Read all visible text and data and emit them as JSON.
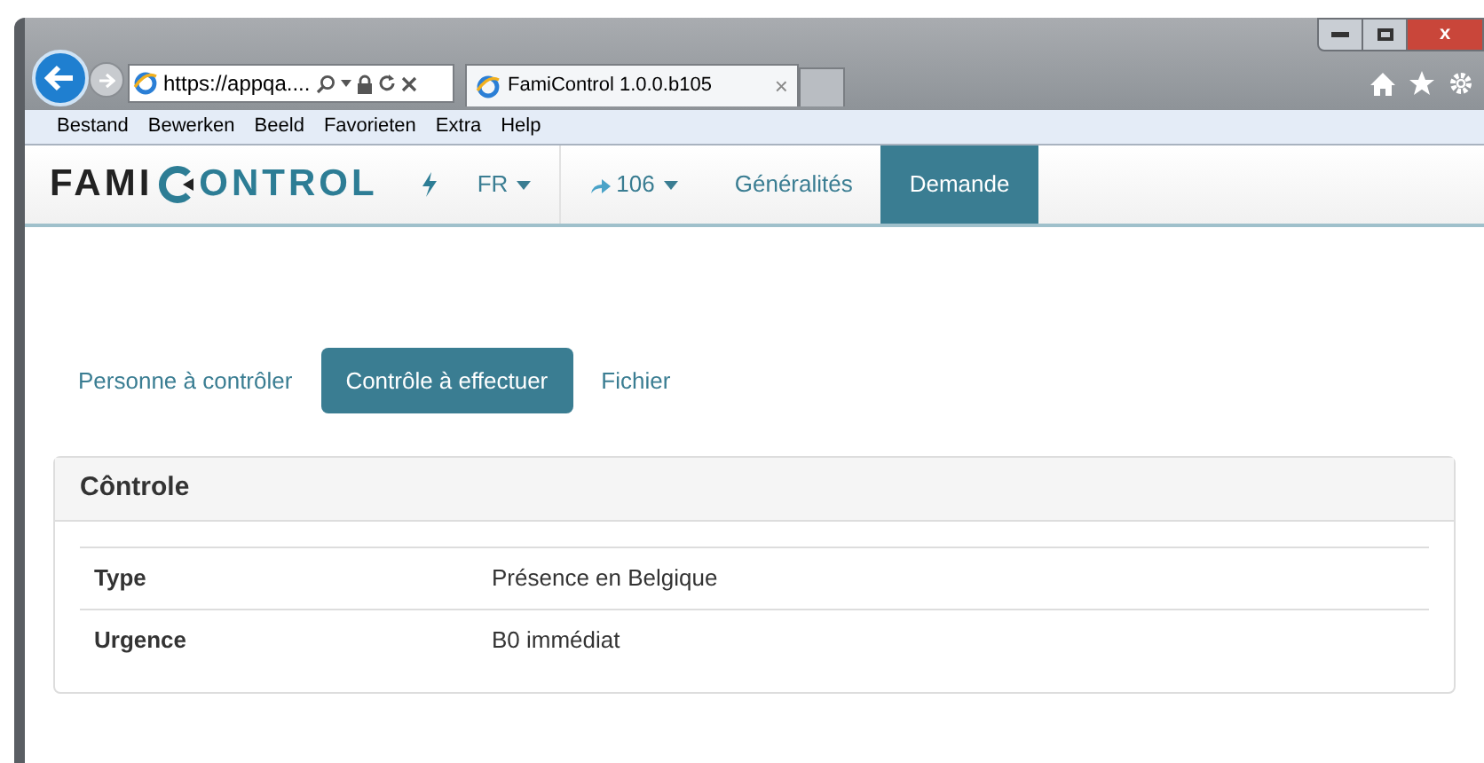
{
  "browser": {
    "address": "https://appqa....",
    "tab_title": "FamiControl 1.0.0.b105",
    "tab_close": "×",
    "close_button": "x"
  },
  "menu": [
    "Bestand",
    "Bewerken",
    "Beeld",
    "Favorieten",
    "Extra",
    "Help"
  ],
  "nav": {
    "logo_start": "FAMI",
    "logo_end": "ONTROL",
    "items": [
      {
        "kind": "bolt"
      },
      {
        "kind": "dropdown",
        "label": "FR",
        "selected": false
      },
      {
        "kind": "share-dropdown",
        "label": "106",
        "selected": false
      },
      {
        "kind": "link",
        "label": "Généralités",
        "selected": false
      },
      {
        "kind": "link",
        "label": "Demande",
        "selected": true
      }
    ]
  },
  "tabs": [
    {
      "label": "Personne à contrôler",
      "selected": false
    },
    {
      "label": "Contrôle à effectuer",
      "selected": true
    },
    {
      "label": "Fichier",
      "selected": false
    }
  ],
  "card": {
    "title": "Côntrole",
    "rows": [
      {
        "label": "Type",
        "value": "Présence en Belgique"
      },
      {
        "label": "Urgence",
        "value": "B0 immédiat"
      }
    ]
  }
}
